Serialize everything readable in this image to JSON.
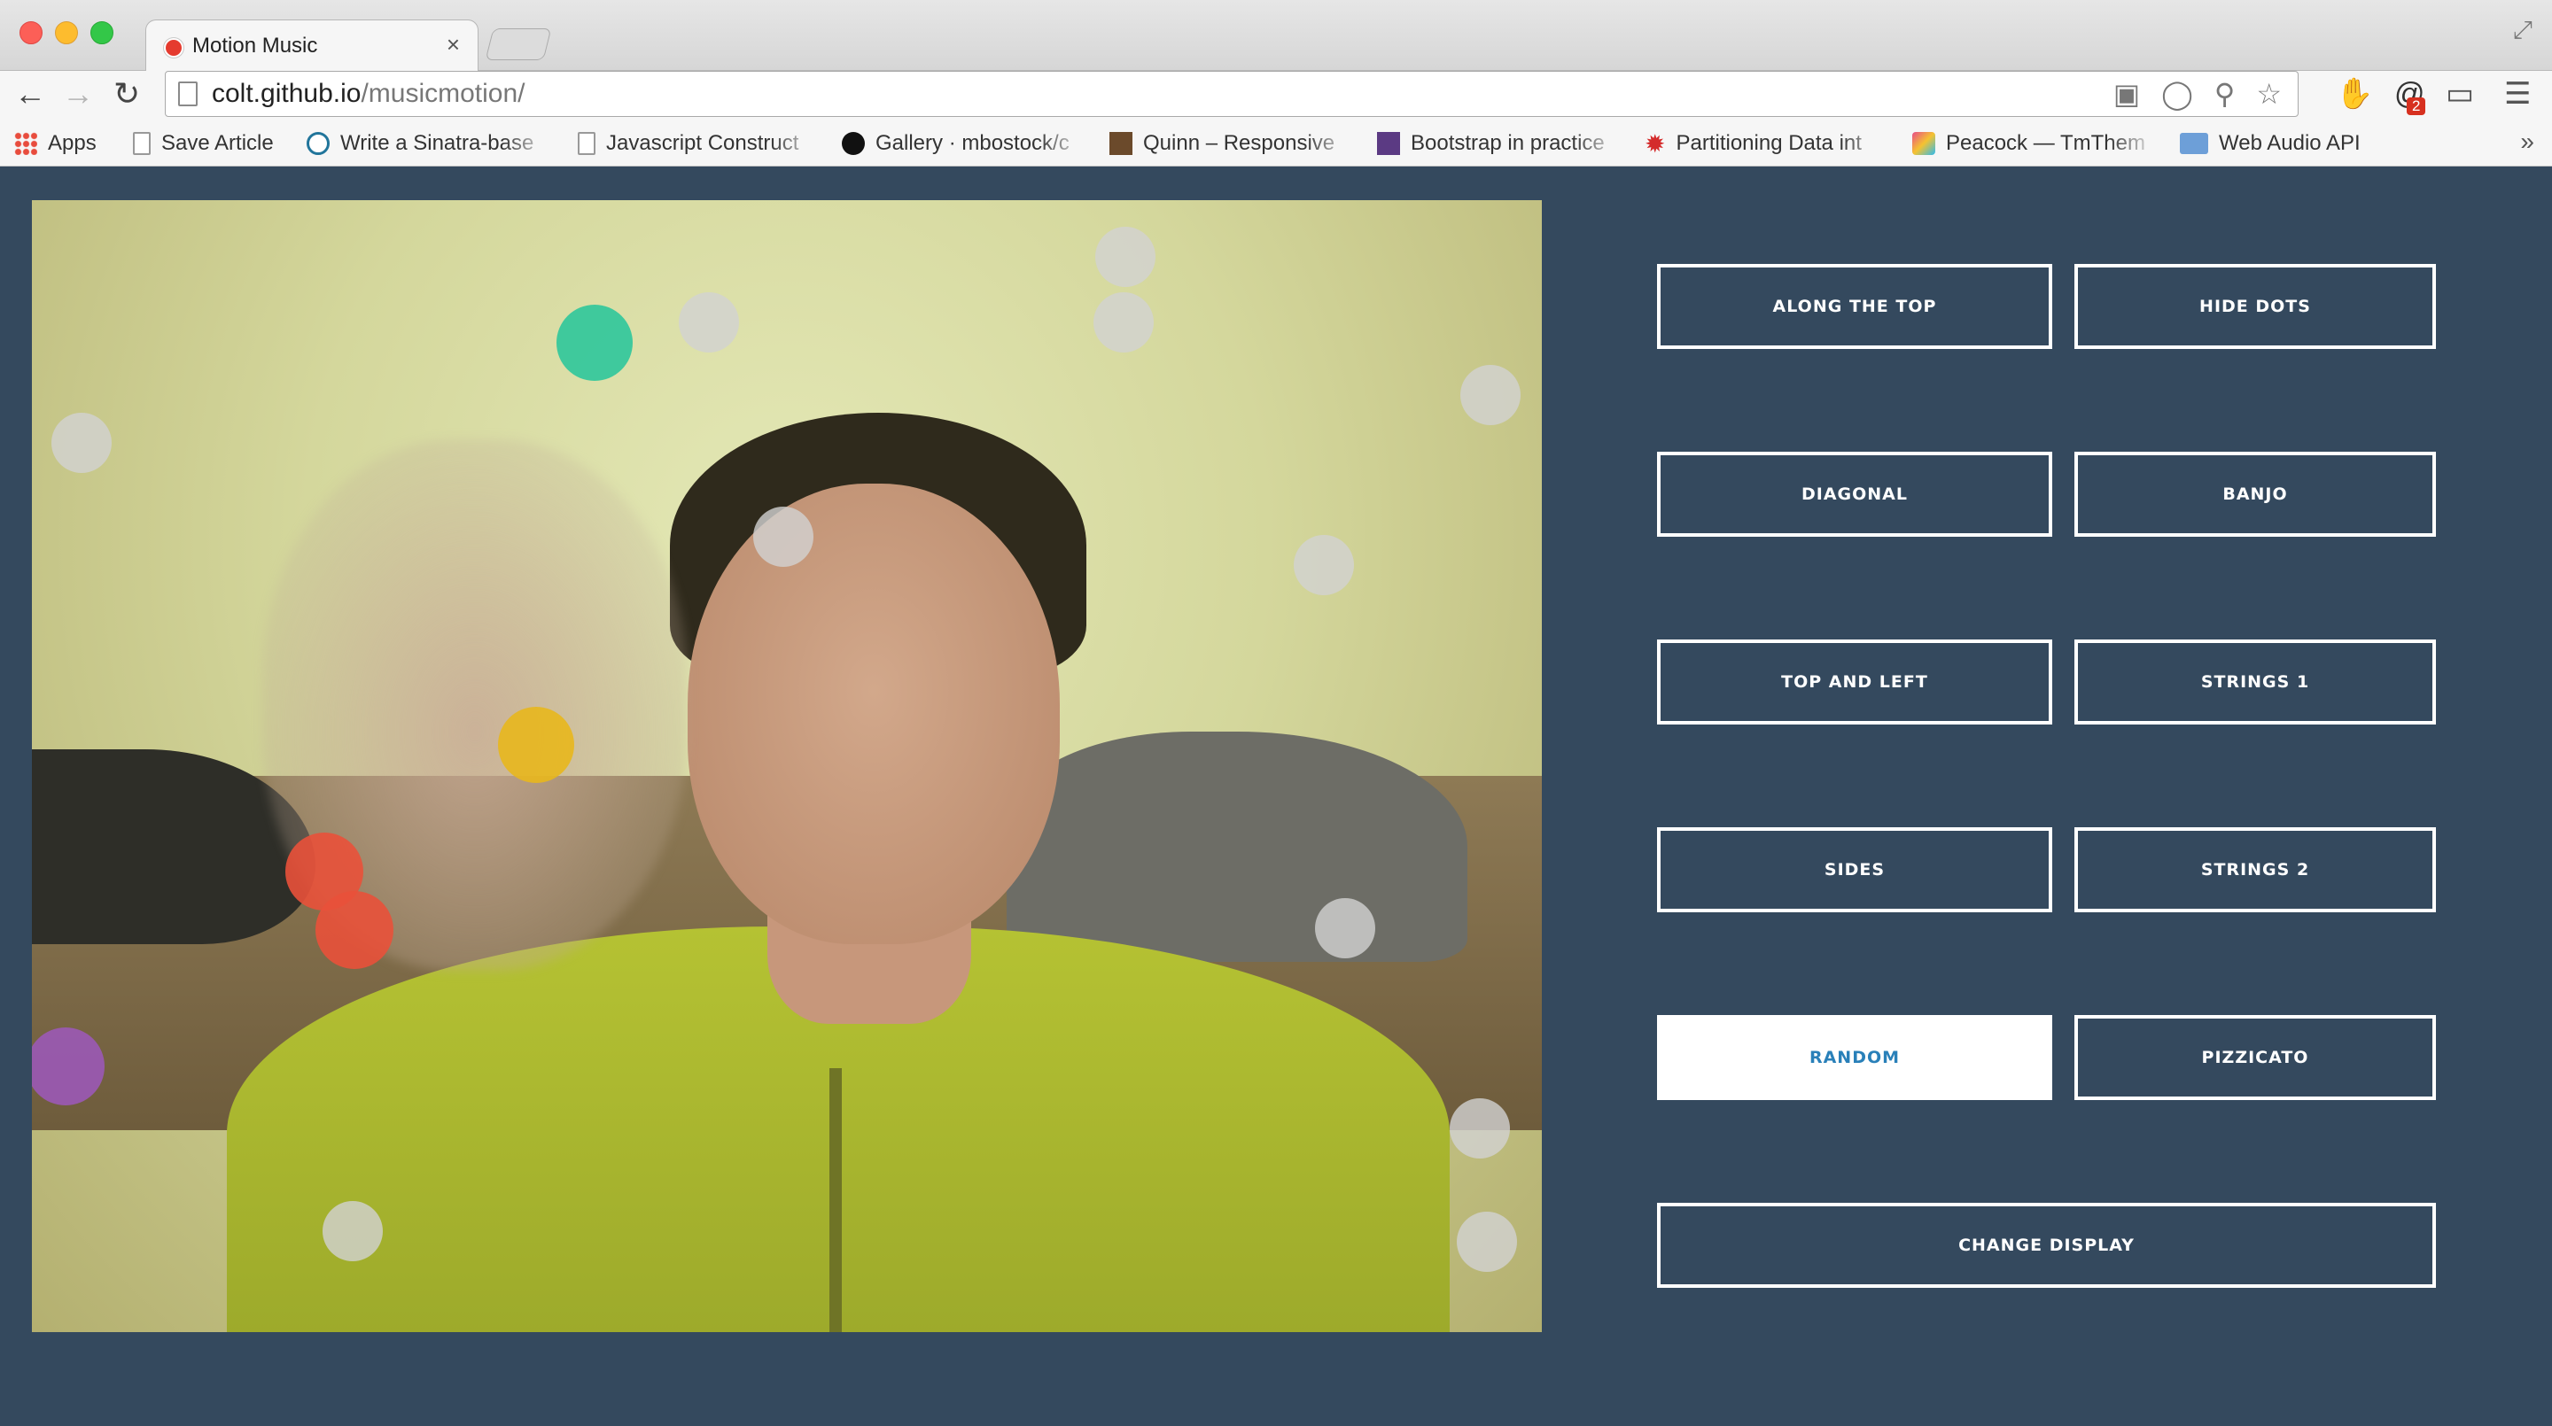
{
  "browser": {
    "tab_title": "Motion Music",
    "tab_close": "×",
    "fullscreen_icon": "⤢",
    "url_host": "colt.github.io",
    "url_path": "/musicmotion/",
    "ext_badge": "2",
    "icons": {
      "back": "arrow-left-icon",
      "forward": "arrow-right-icon",
      "reload": "reload-icon",
      "menu": "hamburger-menu-icon"
    }
  },
  "bookmarks": [
    {
      "label": "Apps",
      "icon": "apps-grid-icon"
    },
    {
      "label": "Save Article",
      "icon": "page-icon"
    },
    {
      "label": "Write a Sinatra-base",
      "icon": "wordpress-icon"
    },
    {
      "label": "Javascript Construct",
      "icon": "page-icon"
    },
    {
      "label": "Gallery · mbostock/c",
      "icon": "github-icon"
    },
    {
      "label": "Quinn – Responsive",
      "icon": "quinn-icon"
    },
    {
      "label": "Bootstrap in practice",
      "icon": "bootstrap-icon"
    },
    {
      "label": "Partitioning Data int",
      "icon": "star-icon"
    },
    {
      "label": "Peacock — TmThem",
      "icon": "peacock-icon"
    },
    {
      "label": "Web Audio API",
      "icon": "folder-icon"
    }
  ],
  "bookmarks_more": "»",
  "controls": {
    "along_top": "ALONG THE TOP",
    "hide_dots": "HIDE DOTS",
    "diagonal": "DIAGONAL",
    "banjo": "BANJO",
    "top_and_left": "TOP AND LEFT",
    "strings_1": "STRINGS 1",
    "sides": "SIDES",
    "strings_2": "STRINGS 2",
    "random": "RANDOM",
    "pizzicato": "PIZZICATO",
    "change_display": "CHANGE DISPLAY",
    "active": "random"
  },
  "colors": {
    "background": "#34495e",
    "button_border": "#ffffff",
    "active_button_text": "#2980b9",
    "dot_inactive": "rgba(210,210,210,0.8)",
    "dot_teal": "#2dc69b",
    "dot_yellow": "#e8b71d",
    "dot_red": "#e9513a",
    "dot_purple": "#9b59b6"
  },
  "dots": [
    {
      "name": "dot-teal",
      "color": "teal"
    },
    {
      "name": "dot-yellow",
      "color": "yellow"
    },
    {
      "name": "dot-red",
      "color": "red"
    },
    {
      "name": "dot-red",
      "color": "red"
    },
    {
      "name": "dot-purple",
      "color": "purple"
    },
    {
      "name": "dot-grey",
      "color": "grey"
    },
    {
      "name": "dot-grey",
      "color": "grey"
    },
    {
      "name": "dot-grey",
      "color": "grey"
    },
    {
      "name": "dot-grey",
      "color": "grey"
    },
    {
      "name": "dot-grey",
      "color": "grey"
    },
    {
      "name": "dot-grey",
      "color": "grey"
    },
    {
      "name": "dot-grey",
      "color": "grey"
    },
    {
      "name": "dot-grey",
      "color": "grey"
    },
    {
      "name": "dot-grey",
      "color": "grey"
    },
    {
      "name": "dot-grey",
      "color": "grey"
    },
    {
      "name": "dot-grey",
      "color": "grey"
    },
    {
      "name": "dot-grey",
      "color": "grey"
    }
  ]
}
